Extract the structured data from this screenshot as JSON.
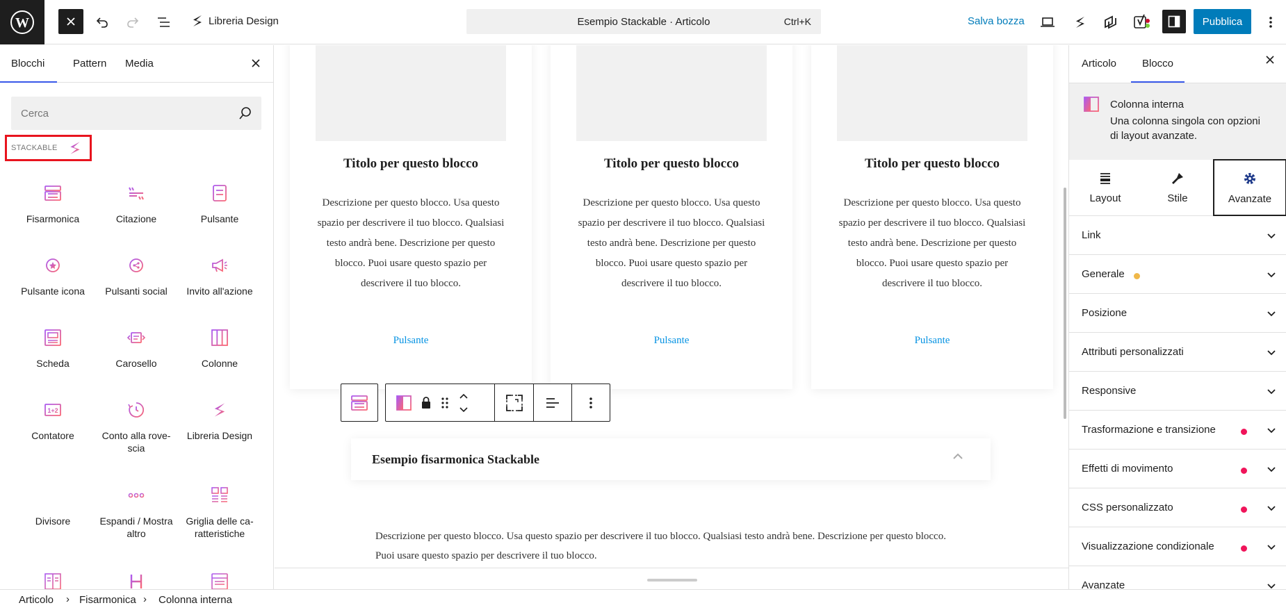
{
  "topbar": {
    "site_title": "Libreria Design",
    "command_title": "Esempio Stackable · Articolo",
    "command_shortcut": "Ctrl+K",
    "save_draft": "Salva bozza",
    "publish": "Pubblica"
  },
  "inserter": {
    "tabs": [
      "Blocchi",
      "Pattern",
      "Media"
    ],
    "active_tab": "Blocchi",
    "search_placeholder": "Cerca",
    "category": "STACKABLE",
    "blocks": [
      {
        "label": "Fisarmonica",
        "icon": "accordion-icon"
      },
      {
        "label": "Citazione",
        "icon": "quote-icon"
      },
      {
        "label": "Pulsante",
        "icon": "button-icon"
      },
      {
        "label": "Pulsante icona",
        "icon": "icon-button-icon"
      },
      {
        "label": "Pulsanti social",
        "icon": "social-buttons-icon"
      },
      {
        "label": "Invito all'azione",
        "icon": "megaphone-icon"
      },
      {
        "label": "Scheda",
        "icon": "card-icon"
      },
      {
        "label": "Carosello",
        "icon": "carousel-icon"
      },
      {
        "label": "Colonne",
        "icon": "columns-icon"
      },
      {
        "label": "Contatore",
        "icon": "counter-icon"
      },
      {
        "label": "Conto alla rove-scia",
        "icon": "countdown-icon"
      },
      {
        "label": "Libreria Design",
        "icon": "stackable-logo-icon"
      },
      {
        "label": "Divisore",
        "icon": "divider-icon"
      },
      {
        "label": "Espandi / Mostra altro",
        "icon": "expand-icon"
      },
      {
        "label": "Griglia delle ca-ratteristiche",
        "icon": "feature-grid-icon"
      }
    ]
  },
  "canvas": {
    "cards": [
      {
        "title": "Titolo per questo blocco",
        "description": "Descrizione per questo blocco. Usa questo spazio per descrivere il tuo blocco. Qualsiasi testo andrà bene. Descrizione per questo blocco. Puoi usare questo spazio per descrivere il tuo blocco.",
        "button": "Pulsante"
      },
      {
        "title": "Titolo per questo blocco",
        "description": "Descrizione per questo blocco. Usa questo spazio per descrivere il tuo blocco. Qualsiasi testo andrà bene. Descrizione per questo blocco. Puoi usare questo spazio per descrivere il tuo blocco.",
        "button": "Pulsante"
      },
      {
        "title": "Titolo per questo blocco",
        "description": "Descrizione per questo blocco. Usa questo spazio per descrivere il tuo blocco. Qualsiasi testo andrà bene. Descrizione per questo blocco. Puoi usare questo spazio per descrivere il tuo blocco.",
        "button": "Pulsante"
      }
    ],
    "accordion_title": "Esempio fisarmonica Stackable",
    "accordion_description": "Descrizione per questo blocco. Usa questo spazio per descrivere il tuo blocco. Qualsiasi testo andrà bene. Descrizione per questo blocco. Puoi usare questo spazio per descrivere il tuo blocco."
  },
  "sidebar": {
    "tabs": [
      "Articolo",
      "Blocco"
    ],
    "active_tab": "Blocco",
    "block_name": "Colonna interna",
    "block_description": "Una colonna singola con opzioni di layout avanzate.",
    "sub_tabs": [
      "Layout",
      "Stile",
      "Avanzate"
    ],
    "active_sub_tab": "Avanzate",
    "panels": [
      {
        "label": "Link",
        "dot": ""
      },
      {
        "label": "Generale",
        "dot": "#f0b849"
      },
      {
        "label": "Posizione",
        "dot": ""
      },
      {
        "label": "Attributi personalizzati",
        "dot": ""
      },
      {
        "label": "Responsive",
        "dot": ""
      },
      {
        "label": "Trasformazione e transizione",
        "dot": "#f0145a"
      },
      {
        "label": "Effetti di movimento",
        "dot": "#f0145a"
      },
      {
        "label": "CSS personalizzato",
        "dot": "#f0145a"
      },
      {
        "label": "Visualizzazione condizionale",
        "dot": "#f0145a"
      },
      {
        "label": "Avanzate",
        "dot": ""
      }
    ]
  },
  "breadcrumb": [
    "Articolo",
    "Fisarmonica",
    "Colonna interna"
  ],
  "colors": {
    "accent": "#007cba",
    "stackable_gradient_start": "#ab5af1",
    "stackable_gradient_end": "#fb6874",
    "highlight": "#e8141e"
  }
}
